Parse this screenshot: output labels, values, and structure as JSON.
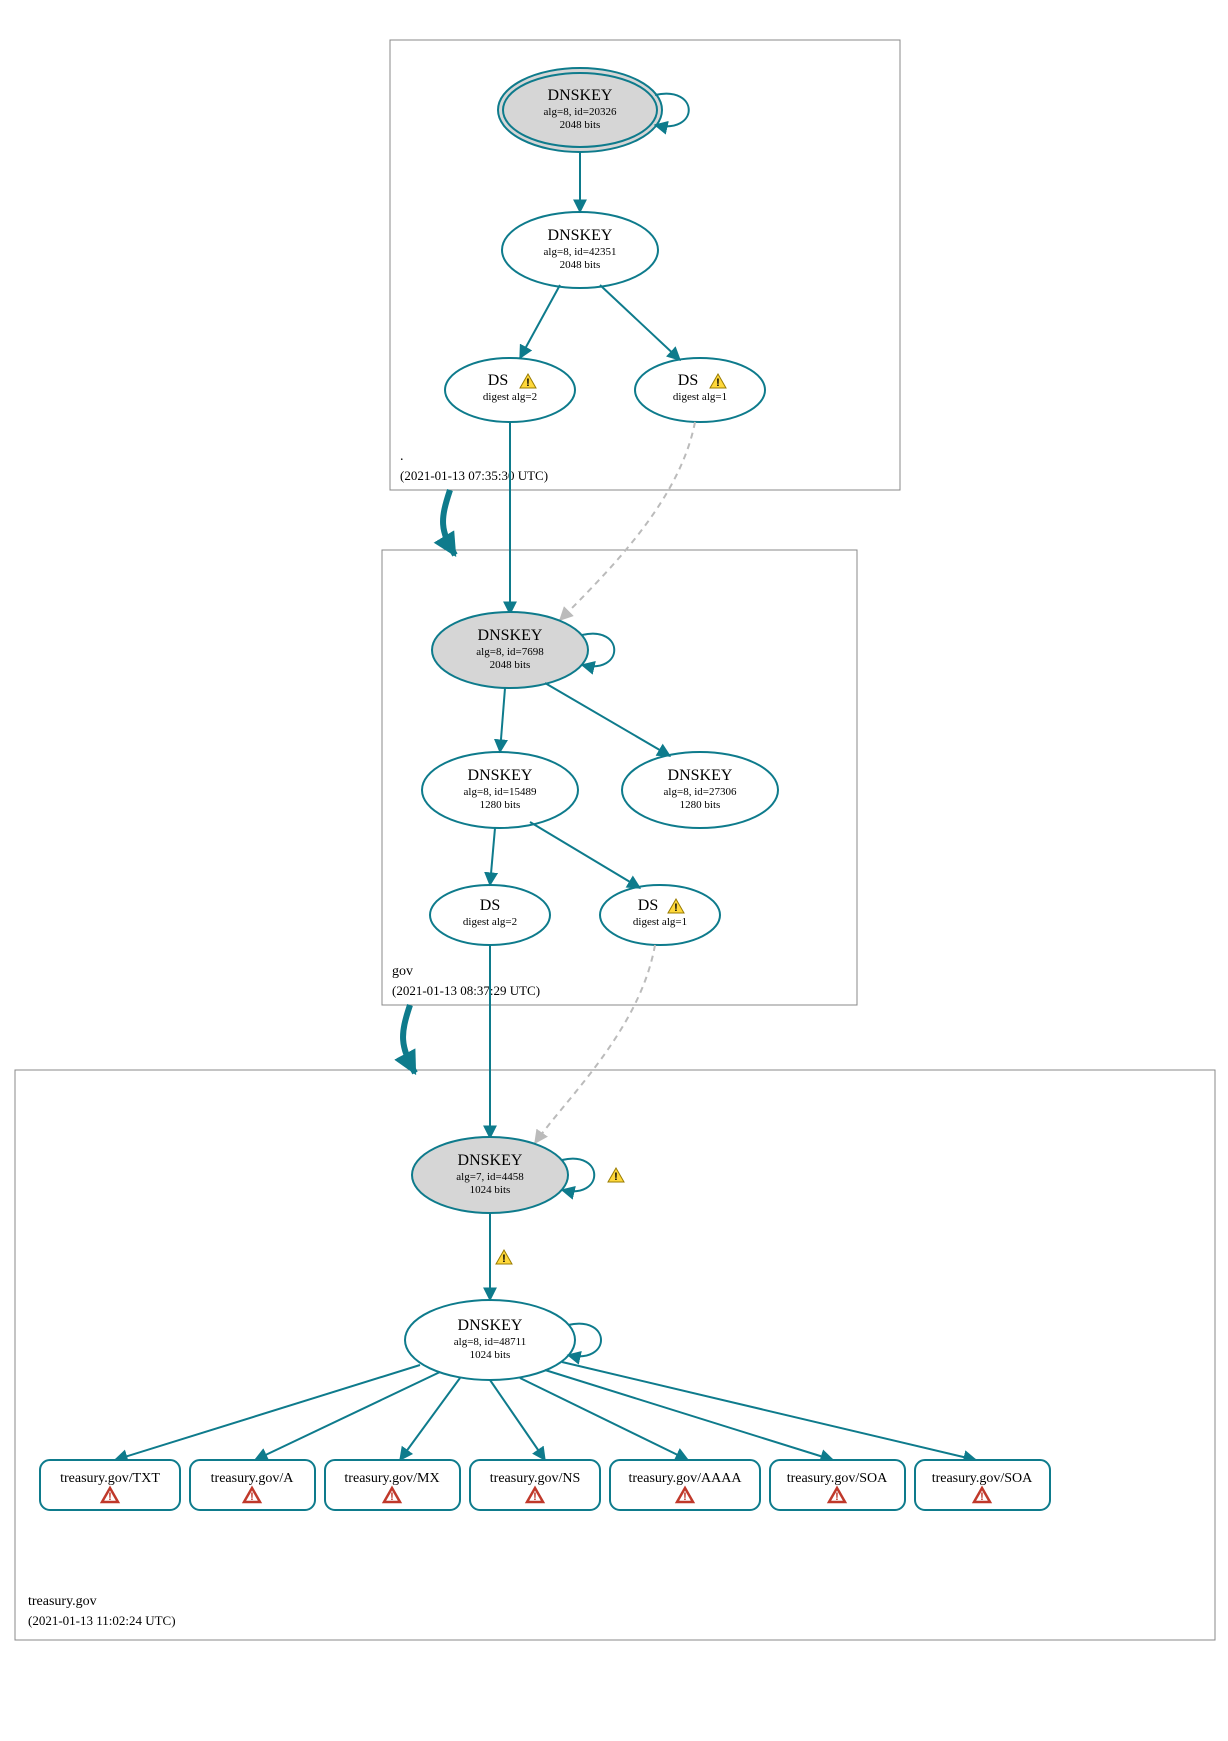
{
  "zones": {
    "root": {
      "name": ".",
      "timestamp": "(2021-01-13 07:35:30 UTC)"
    },
    "gov": {
      "name": "gov",
      "timestamp": "(2021-01-13 08:37:29 UTC)"
    },
    "treasury": {
      "name": "treasury.gov",
      "timestamp": "(2021-01-13 11:02:24 UTC)"
    }
  },
  "nodes": {
    "root_ksk": {
      "title": "DNSKEY",
      "line2": "alg=8, id=20326",
      "line3": "2048 bits"
    },
    "root_zsk": {
      "title": "DNSKEY",
      "line2": "alg=8, id=42351",
      "line3": "2048 bits"
    },
    "root_ds1": {
      "title": "DS",
      "line2": "digest alg=2"
    },
    "root_ds2": {
      "title": "DS",
      "line2": "digest alg=1"
    },
    "gov_ksk": {
      "title": "DNSKEY",
      "line2": "alg=8, id=7698",
      "line3": "2048 bits"
    },
    "gov_zsk1": {
      "title": "DNSKEY",
      "line2": "alg=8, id=15489",
      "line3": "1280 bits"
    },
    "gov_zsk2": {
      "title": "DNSKEY",
      "line2": "alg=8, id=27306",
      "line3": "1280 bits"
    },
    "gov_ds1": {
      "title": "DS",
      "line2": "digest alg=2"
    },
    "gov_ds2": {
      "title": "DS",
      "line2": "digest alg=1"
    },
    "tre_ksk": {
      "title": "DNSKEY",
      "line2": "alg=7, id=4458",
      "line3": "1024 bits"
    },
    "tre_zsk": {
      "title": "DNSKEY",
      "line2": "alg=8, id=48711",
      "line3": "1024 bits"
    }
  },
  "records": {
    "r0": "treasury.gov/TXT",
    "r1": "treasury.gov/A",
    "r2": "treasury.gov/MX",
    "r3": "treasury.gov/NS",
    "r4": "treasury.gov/AAAA",
    "r5": "treasury.gov/SOA",
    "r6": "treasury.gov/SOA"
  }
}
